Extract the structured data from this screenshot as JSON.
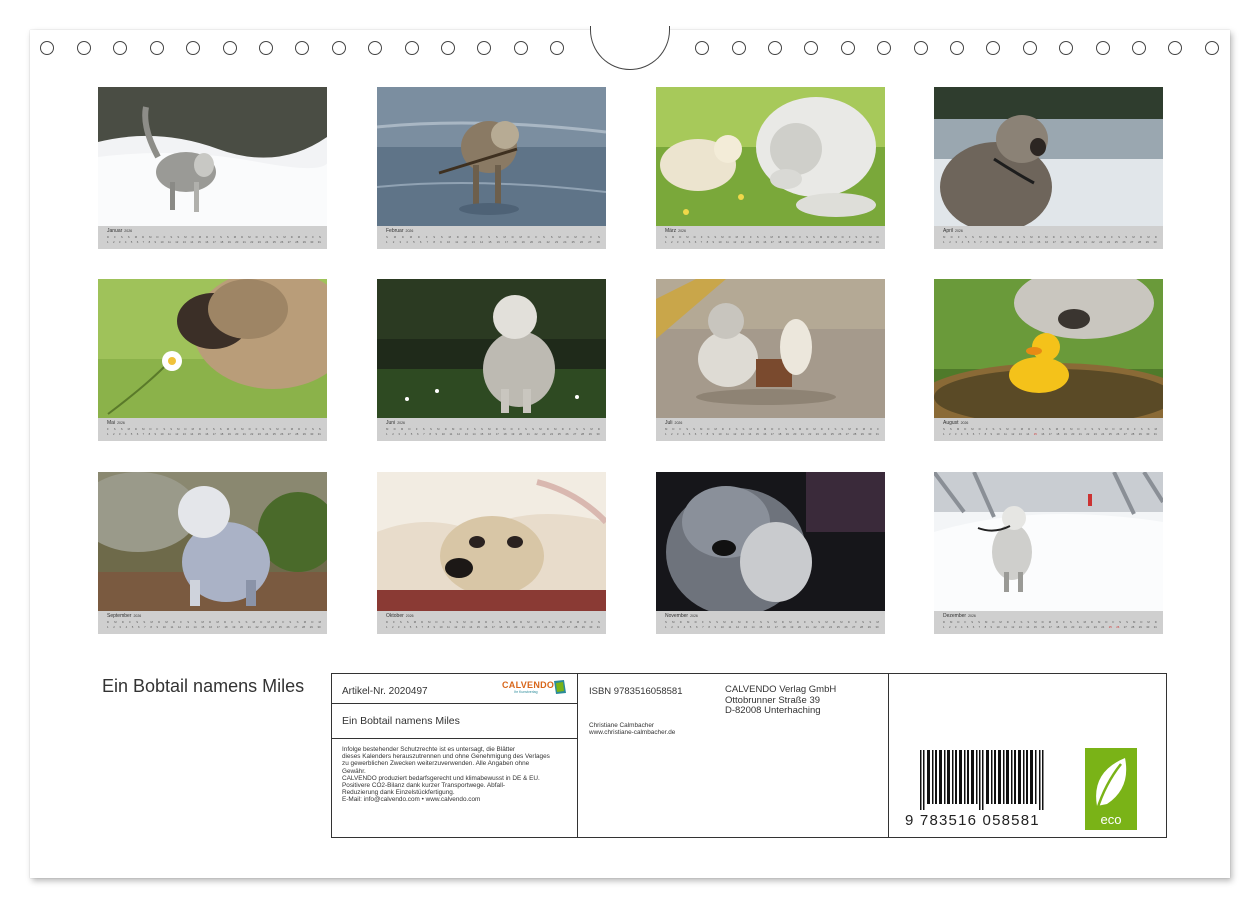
{
  "title": "Ein Bobtail namens Miles",
  "months": [
    {
      "id": "jan",
      "name": "Januar",
      "year": "2026"
    },
    {
      "id": "feb",
      "name": "Februar",
      "year": "2026"
    },
    {
      "id": "mar",
      "name": "März",
      "year": "2026"
    },
    {
      "id": "apr",
      "name": "April",
      "year": "2026"
    },
    {
      "id": "may",
      "name": "Mai",
      "year": "2026"
    },
    {
      "id": "jun",
      "name": "Juni",
      "year": "2026"
    },
    {
      "id": "jul",
      "name": "Juli",
      "year": "2026"
    },
    {
      "id": "aug",
      "name": "August",
      "year": "2026"
    },
    {
      "id": "sep",
      "name": "September",
      "year": "2026"
    },
    {
      "id": "oct",
      "name": "Oktober",
      "year": "2026"
    },
    {
      "id": "nov",
      "name": "November",
      "year": "2026"
    },
    {
      "id": "dec",
      "name": "Dezember",
      "year": "2026"
    }
  ],
  "info": {
    "artikel": "Artikel-Nr. 2020497",
    "logo_text": "CALVENDO",
    "logo_sub": "Ihr Kunstverlag",
    "box_title": "Ein Bobtail namens Miles",
    "legal": [
      "Infolge bestehender Schutzrechte ist es untersagt, die Blätter",
      "dieses Kalenders herauszutrennen und ohne Genehmigung des Verlages",
      "zu gewerblichen Zwecken weiterzuverwenden. Alle Angaben ohne",
      "Gewähr.",
      "CALVENDO produziert bedarfsgerecht und klimabewusst in DE & EU.",
      "Positivere CO2-Bilanz dank kurzer Transportwege. Abfall-",
      "Reduzierung dank Einzelstückfertigung.",
      "E-Mail: info@calvendo.com • www.calvendo.com"
    ],
    "isbn": "ISBN 9783516058581",
    "author_name": "Christiane Calmbacher",
    "author_web": "www.christiane-calmbacher.de",
    "publisher": [
      "CALVENDO Verlag GmbH",
      "Ottobrunner Straße 39",
      "D-82008 Unterhaching"
    ],
    "barcode_digits": "9  783516  058581",
    "eco_label": "eco"
  },
  "colors": {
    "eco_green": "#7ab317",
    "logo_orange": "#d8661a",
    "logo_teal": "#2a8a99",
    "strip_gray": "#cfcfcf"
  }
}
